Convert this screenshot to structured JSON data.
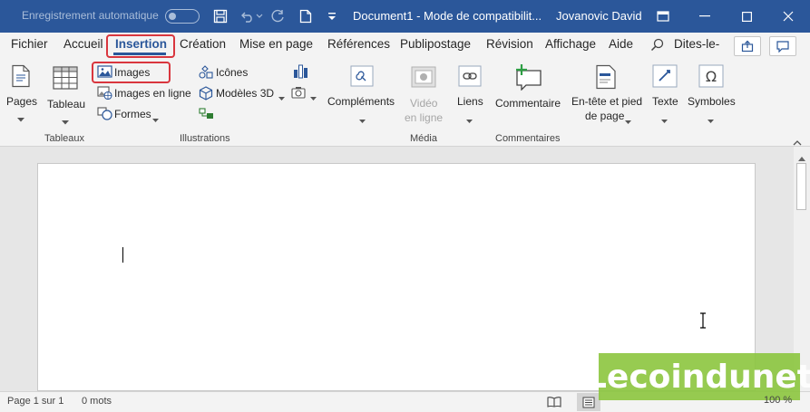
{
  "titlebar": {
    "autosave_label": "Enregistrement automatique",
    "document_title": "Document1  -  Mode de compatibilit...",
    "user_name": "Jovanovic David"
  },
  "tabs": [
    {
      "label": "Fichier"
    },
    {
      "label": "Accueil"
    },
    {
      "label": "Insertion"
    },
    {
      "label": "Création"
    },
    {
      "label": "Mise en page"
    },
    {
      "label": "Références"
    },
    {
      "label": "Publipostage"
    },
    {
      "label": "Révision"
    },
    {
      "label": "Affichage"
    },
    {
      "label": "Aide"
    },
    {
      "label": "Dites-le-"
    }
  ],
  "ribbon": {
    "pages": "Pages",
    "tableau": "Tableau",
    "images": "Images",
    "images_en_ligne": "Images en ligne",
    "formes": "Formes",
    "icones": "Icônes",
    "modeles_3d": "Modèles 3D",
    "complements": "Compléments",
    "video_line1": "Vidéo",
    "video_line2": "en ligne",
    "liens": "Liens",
    "commentaire": "Commentaire",
    "entete_line1": "En-tête et pied",
    "entete_line2": "de page",
    "texte": "Texte",
    "symboles": "Symboles",
    "groups": {
      "tableaux": "Tableaux",
      "illustrations": "Illustrations",
      "media": "Média",
      "commentaires": "Commentaires"
    }
  },
  "statusbar": {
    "page": "Page 1 sur 1",
    "words": "0 mots",
    "zoom": "100 %"
  },
  "watermark": {
    "text": "Lecoindunet"
  },
  "colors": {
    "title_bar": "#2b579a",
    "highlight": "#d9363e",
    "watermark": "#8cc63f"
  }
}
